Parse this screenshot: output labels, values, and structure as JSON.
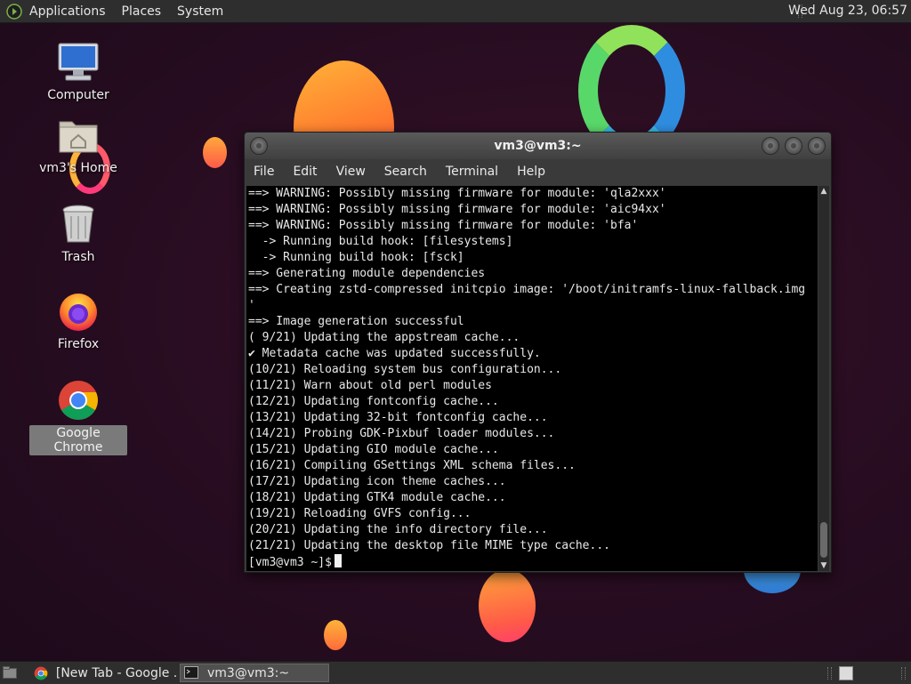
{
  "top_panel": {
    "menus": [
      "Applications",
      "Places",
      "System"
    ],
    "clock": "Wed Aug 23, 06:57"
  },
  "desktop_icons": [
    {
      "label": "Computer",
      "icon": "computer-icon"
    },
    {
      "label": "vm3's Home",
      "icon": "home-folder-icon"
    },
    {
      "label": "Trash",
      "icon": "trash-icon"
    },
    {
      "label": "Firefox",
      "icon": "firefox-icon"
    },
    {
      "label": "Google Chrome",
      "icon": "chrome-icon",
      "selected": true
    }
  ],
  "terminal": {
    "title": "vm3@vm3:~",
    "menus": [
      "File",
      "Edit",
      "View",
      "Search",
      "Terminal",
      "Help"
    ],
    "lines": [
      "==> WARNING: Possibly missing firmware for module: 'qla2xxx'",
      "==> WARNING: Possibly missing firmware for module: 'aic94xx'",
      "==> WARNING: Possibly missing firmware for module: 'bfa'",
      "  -> Running build hook: [filesystems]",
      "  -> Running build hook: [fsck]",
      "==> Generating module dependencies",
      "==> Creating zstd-compressed initcpio image: '/boot/initramfs-linux-fallback.img",
      "'",
      "==> Image generation successful",
      "( 9/21) Updating the appstream cache...",
      "✔ Metadata cache was updated successfully.",
      "(10/21) Reloading system bus configuration...",
      "(11/21) Warn about old perl modules",
      "(12/21) Updating fontconfig cache...",
      "(13/21) Updating 32-bit fontconfig cache...",
      "(14/21) Probing GDK-Pixbuf loader modules...",
      "(15/21) Updating GIO module cache...",
      "(16/21) Compiling GSettings XML schema files...",
      "(17/21) Updating icon theme caches...",
      "(18/21) Updating GTK4 module cache...",
      "(19/21) Reloading GVFS config...",
      "(20/21) Updating the info directory file...",
      "(21/21) Updating the desktop file MIME type cache..."
    ],
    "prompt": "[vm3@vm3 ~]$"
  },
  "taskbar": {
    "tasks": [
      {
        "label": "[New Tab - Google ...",
        "icon": "chrome-icon",
        "active": false
      },
      {
        "label": "vm3@vm3:~",
        "icon": "terminal-icon",
        "active": true
      }
    ]
  },
  "colors": {
    "panel": "#2e2e2e",
    "terminal_bg": "#000000",
    "terminal_fg": "#e8e8e8",
    "desktop_bg": "#2a0d22"
  }
}
